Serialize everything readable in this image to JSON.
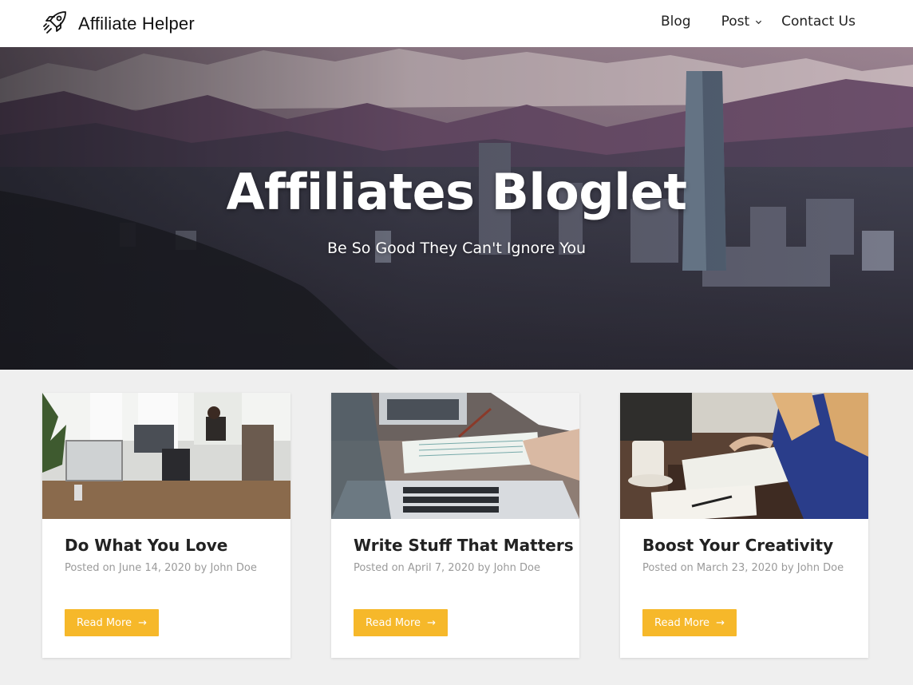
{
  "header": {
    "brand_name": "Affiliate Helper",
    "brand_icon": "rocket-icon",
    "nav": [
      {
        "label": "Blog"
      },
      {
        "label": "Post",
        "has_dropdown": true
      },
      {
        "label": "Contact Us"
      }
    ]
  },
  "hero": {
    "title": "Affiliates Bloglet",
    "subtitle": "Be So Good They Can't Ignore You"
  },
  "posts": [
    {
      "title": "Do What You Love",
      "meta": "Posted on June 14, 2020 by John Doe",
      "button": "Read More",
      "button_icon": "arrow-right-icon"
    },
    {
      "title": "Write Stuff That Matters",
      "meta": "Posted on April 7, 2020 by John Doe",
      "button": "Read More",
      "button_icon": "arrow-right-icon"
    },
    {
      "title": "Boost Your Creativity",
      "meta": "Posted on March 23, 2020 by John Doe",
      "button": "Read More",
      "button_icon": "arrow-right-icon"
    }
  ],
  "colors": {
    "accent": "#f6b82a",
    "background": "#efefef",
    "meta_text": "#9a9a9a"
  }
}
